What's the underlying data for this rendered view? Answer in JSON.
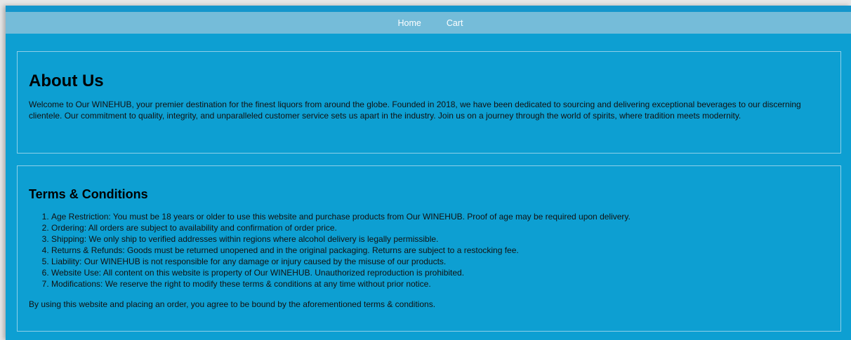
{
  "nav": {
    "items": [
      {
        "label": "Home"
      },
      {
        "label": "Cart"
      }
    ]
  },
  "about": {
    "title": "About Us",
    "text": "Welcome to Our WINEHUB, your premier destination for the finest liquors from around the globe. Founded in 2018, we have been dedicated to sourcing and delivering exceptional beverages to our discerning clientele. Our commitment to quality, integrity, and unparalleled customer service sets us apart in the industry. Join us on a journey through the world of spirits, where tradition meets modernity."
  },
  "terms": {
    "title": "Terms & Conditions",
    "items": [
      "Age Restriction: You must be 18 years or older to use this website and purchase products from Our WINEHUB. Proof of age may be required upon delivery.",
      "Ordering: All orders are subject to availability and confirmation of order price.",
      "Shipping: We only ship to verified addresses within regions where alcohol delivery is legally permissible.",
      "Returns & Refunds: Goods must be returned unopened and in the original packaging. Returns are subject to a restocking fee.",
      "Liability: Our WINEHUB is not responsible for any damage or injury caused by the misuse of our products.",
      "Website Use: All content on this website is property of Our WINEHUB. Unauthorized reproduction is prohibited.",
      "Modifications: We reserve the right to modify these terms & conditions at any time without prior notice."
    ],
    "closing": "By using this website and placing an order, you agree to be bound by the aforementioned terms & conditions."
  },
  "colors": {
    "page_background": "#0d9fd2",
    "navbar_background": "#75bcd9",
    "top_border": "#1496cc",
    "panel_border": "#8ecfe8"
  }
}
